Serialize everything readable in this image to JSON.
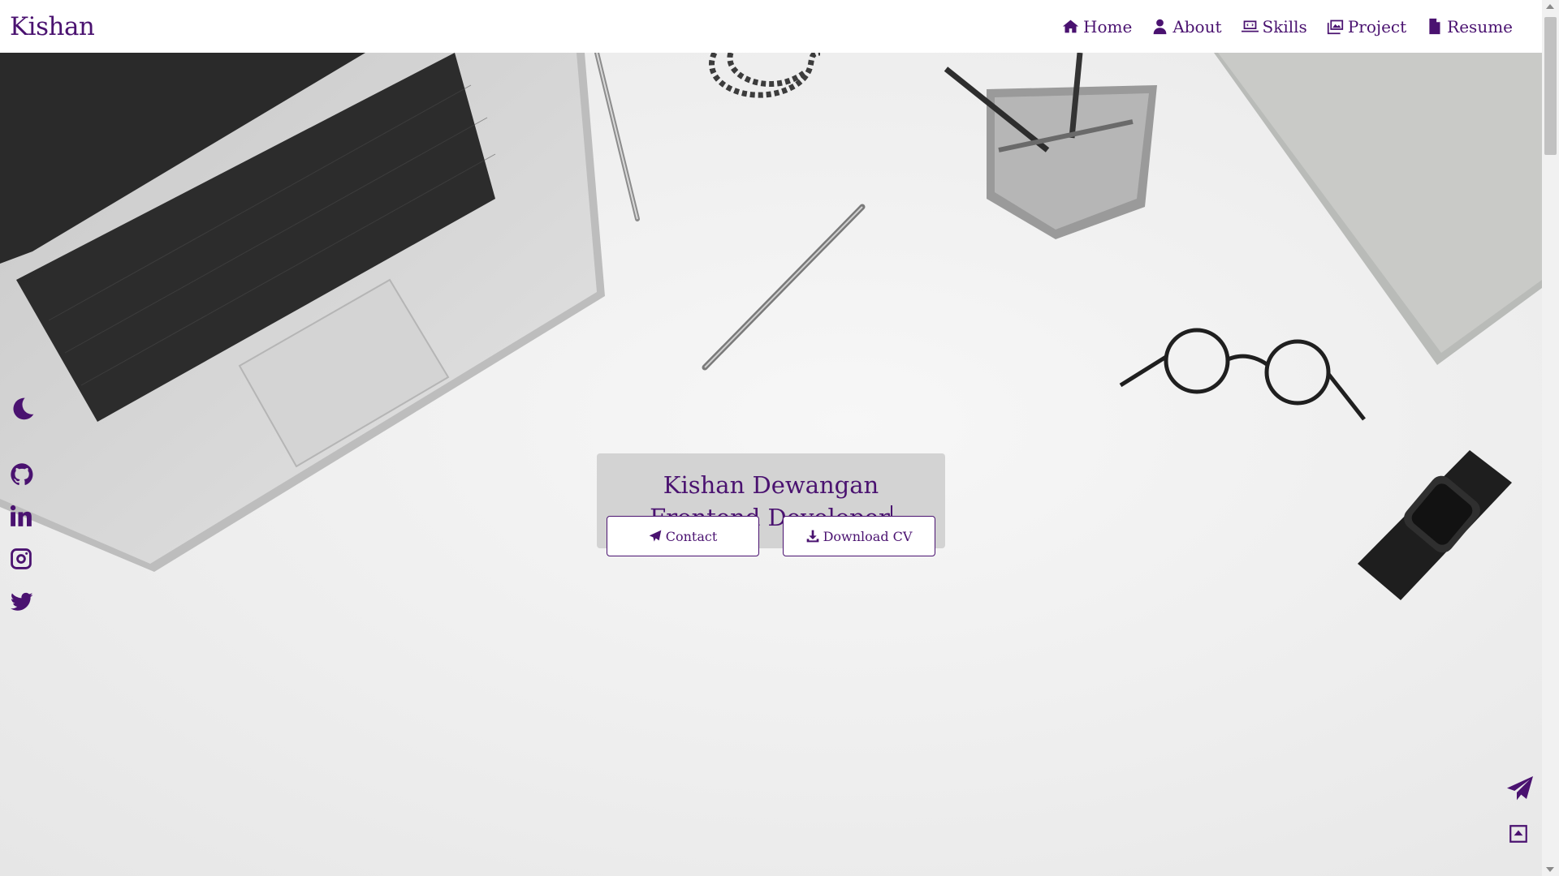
{
  "header": {
    "brand": "Kishan",
    "nav": [
      {
        "label": "Home",
        "icon": "home-icon"
      },
      {
        "label": "About",
        "icon": "user-icon"
      },
      {
        "label": "Skills",
        "icon": "laptop-code-icon"
      },
      {
        "label": "Project",
        "icon": "images-icon"
      },
      {
        "label": "Resume",
        "icon": "file-icon"
      }
    ]
  },
  "hero": {
    "name": "Kishan Dewangan",
    "role": "Frontend Developer",
    "buttons": {
      "contact": "Contact",
      "download": "Download CV"
    }
  },
  "sidebar": {
    "icons": [
      "moon-icon",
      "github-icon",
      "linkedin-icon",
      "instagram-icon",
      "twitter-icon"
    ]
  },
  "floating": {
    "icons": [
      "paper-plane-icon",
      "scroll-top-icon"
    ]
  },
  "colors": {
    "accent": "#4a1270",
    "title_box": "#d3d3d3",
    "background": "#ededed"
  }
}
